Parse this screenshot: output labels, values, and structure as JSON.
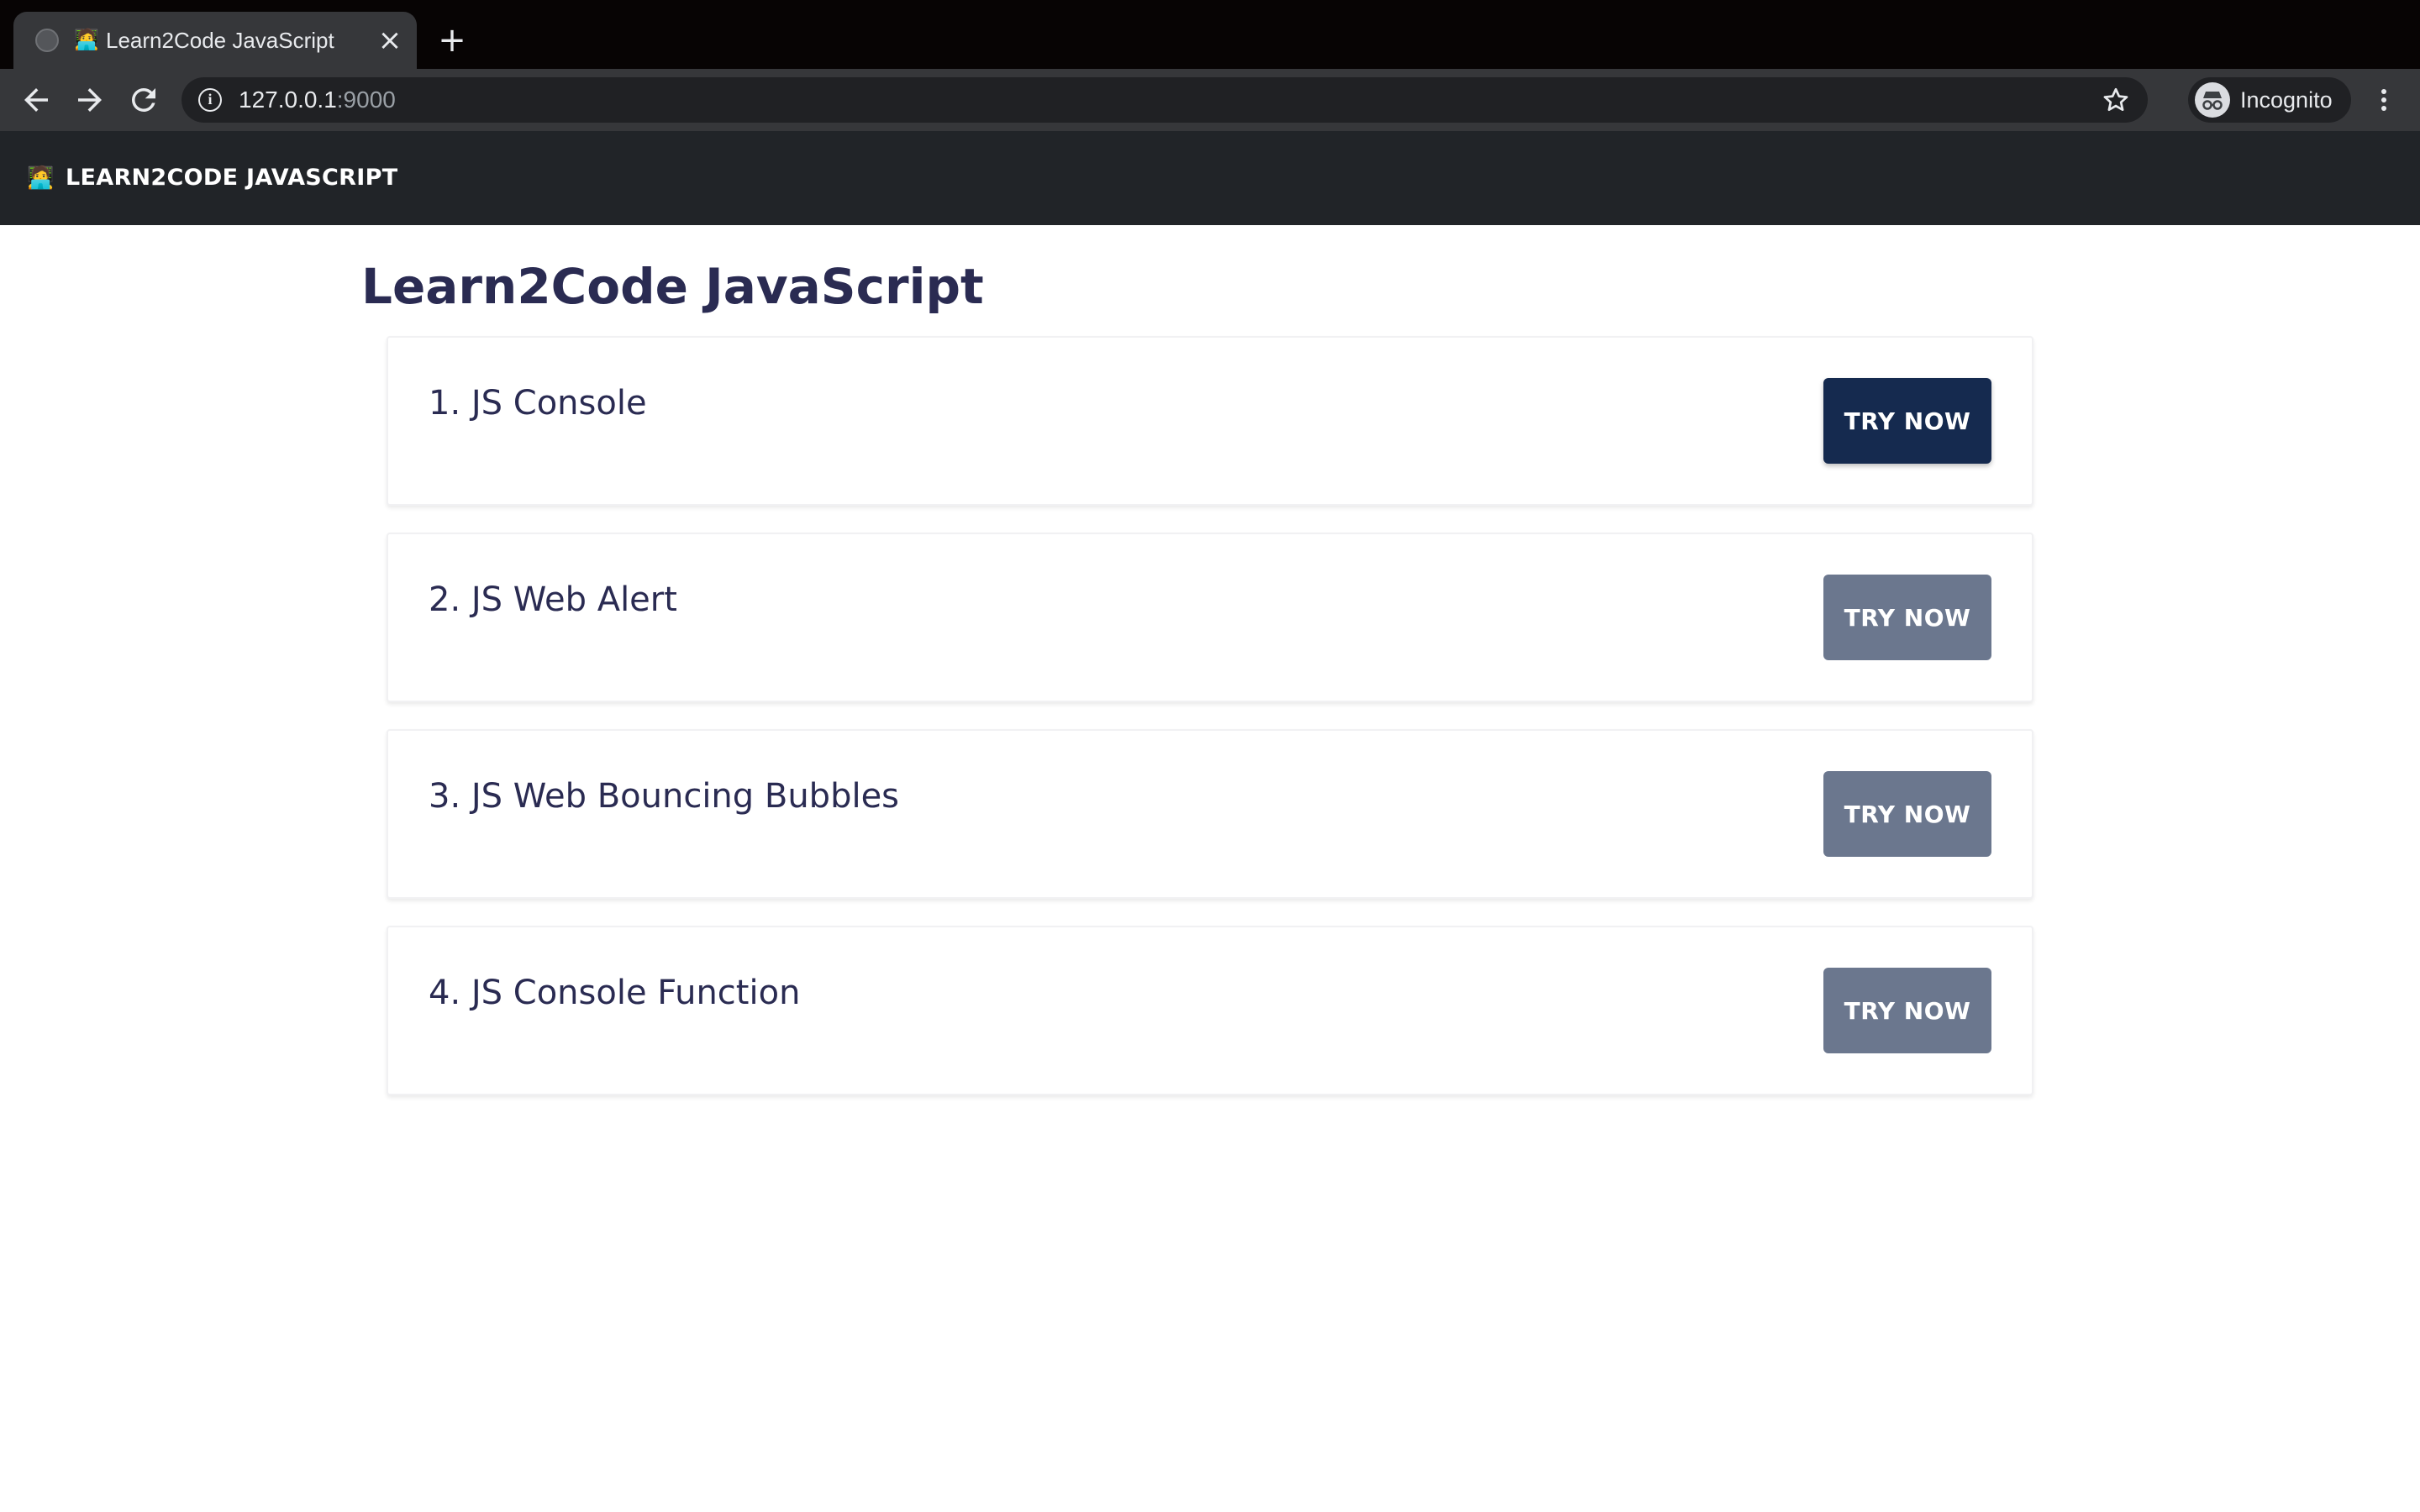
{
  "browser": {
    "tab_title": "Learn2Code JavaScript",
    "tab_favicon": "🧑‍💻",
    "url_host": "127.0.0.1",
    "url_port": ":9000",
    "profile_label": "Incognito"
  },
  "navbar": {
    "brand_emoji": "🧑‍💻",
    "brand_label": "LEARN2CODE JAVASCRIPT"
  },
  "main": {
    "title": "Learn2Code JavaScript",
    "lessons": [
      {
        "title": "1. JS Console",
        "button_label": "TRY NOW"
      },
      {
        "title": "2. JS Web Alert",
        "button_label": "TRY NOW"
      },
      {
        "title": "3. JS Web Bouncing Bubbles",
        "button_label": "TRY NOW"
      },
      {
        "title": "4. JS Console Function",
        "button_label": "TRY NOW"
      }
    ]
  },
  "colors": {
    "navbar_bg": "#212428",
    "heading_text": "#2a2b52",
    "button_primary": "#152a4f",
    "button_muted": "#6b778e"
  }
}
